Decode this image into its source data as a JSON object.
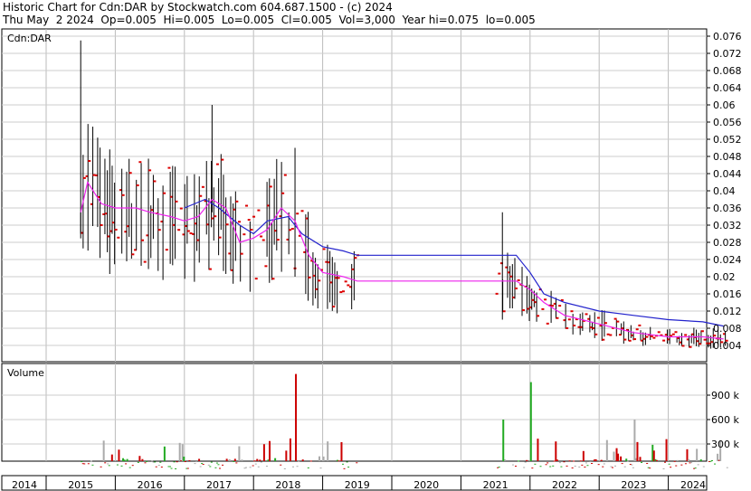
{
  "header": {
    "line1": "Historic Chart for Cdn:DAR by Stockwatch.com 604.687.1500 - (c) 2024",
    "line2": "Thu May  2 2024  Op=0.005  Hi=0.005  Lo=0.005  Cl=0.005  Vol=3,000  Year hi=0.075  lo=0.005"
  },
  "chart_data": [
    {
      "type": "line",
      "title": "Cdn:DAR",
      "ylim": [
        0,
        0.08
      ],
      "y_ticks": [
        "0.076",
        "0.072",
        "0.068",
        "0.064",
        "0.06",
        "0.056",
        "0.052",
        "0.048",
        "0.044",
        "0.04",
        "0.036",
        "0.032",
        "0.028",
        "0.024",
        "0.02",
        "0.016",
        "0.012",
        "0.008",
        "0.004"
      ],
      "grid": true,
      "series": [
        {
          "color": "#2222cc",
          "x": [
            2016.5,
            2016.8,
            2017.0,
            2017.3,
            2017.5,
            2017.7,
            2018.0,
            2018.2,
            2018.5,
            2018.8,
            2019.0,
            2020.0,
            2021.0,
            2021.3,
            2021.5,
            2021.7,
            2022.0,
            2022.5,
            2023.0,
            2023.5,
            2024.0,
            2024.3
          ],
          "values": [
            0.036,
            0.038,
            0.036,
            0.032,
            0.03,
            0.033,
            0.034,
            0.03,
            0.027,
            0.026,
            0.025,
            0.025,
            0.025,
            0.025,
            0.021,
            0.016,
            0.014,
            0.012,
            0.011,
            0.01,
            0.0095,
            0.0085
          ]
        },
        {
          "color": "#ee22ee",
          "x": [
            2015.0,
            2015.1,
            2015.3,
            2015.5,
            2015.8,
            2016.0,
            2016.3,
            2016.5,
            2016.7,
            2016.9,
            2017.1,
            2017.3,
            2017.5,
            2017.7,
            2017.9,
            2018.1,
            2018.3,
            2018.5,
            2018.8,
            2019.0,
            2020.0,
            2021.0,
            2021.3,
            2021.5,
            2021.7,
            2022.0,
            2022.5,
            2023.0,
            2023.5,
            2024.0,
            2024.3
          ],
          "values": [
            0.035,
            0.042,
            0.037,
            0.036,
            0.036,
            0.035,
            0.034,
            0.033,
            0.034,
            0.038,
            0.036,
            0.028,
            0.029,
            0.031,
            0.036,
            0.033,
            0.025,
            0.021,
            0.02,
            0.019,
            0.019,
            0.019,
            0.019,
            0.017,
            0.014,
            0.011,
            0.009,
            0.007,
            0.006,
            0.006,
            0.0055
          ]
        }
      ]
    },
    {
      "type": "bar",
      "title": "Volume",
      "ylim": [
        0,
        1200000
      ],
      "y_ticks": [
        "900 k",
        "600 k",
        "300 k"
      ],
      "x_ticks": [
        "2014",
        "2015",
        "2016",
        "2017",
        "2018",
        "2019",
        "2020",
        "2021",
        "2022",
        "2023",
        "2024"
      ],
      "grid": true
    }
  ]
}
